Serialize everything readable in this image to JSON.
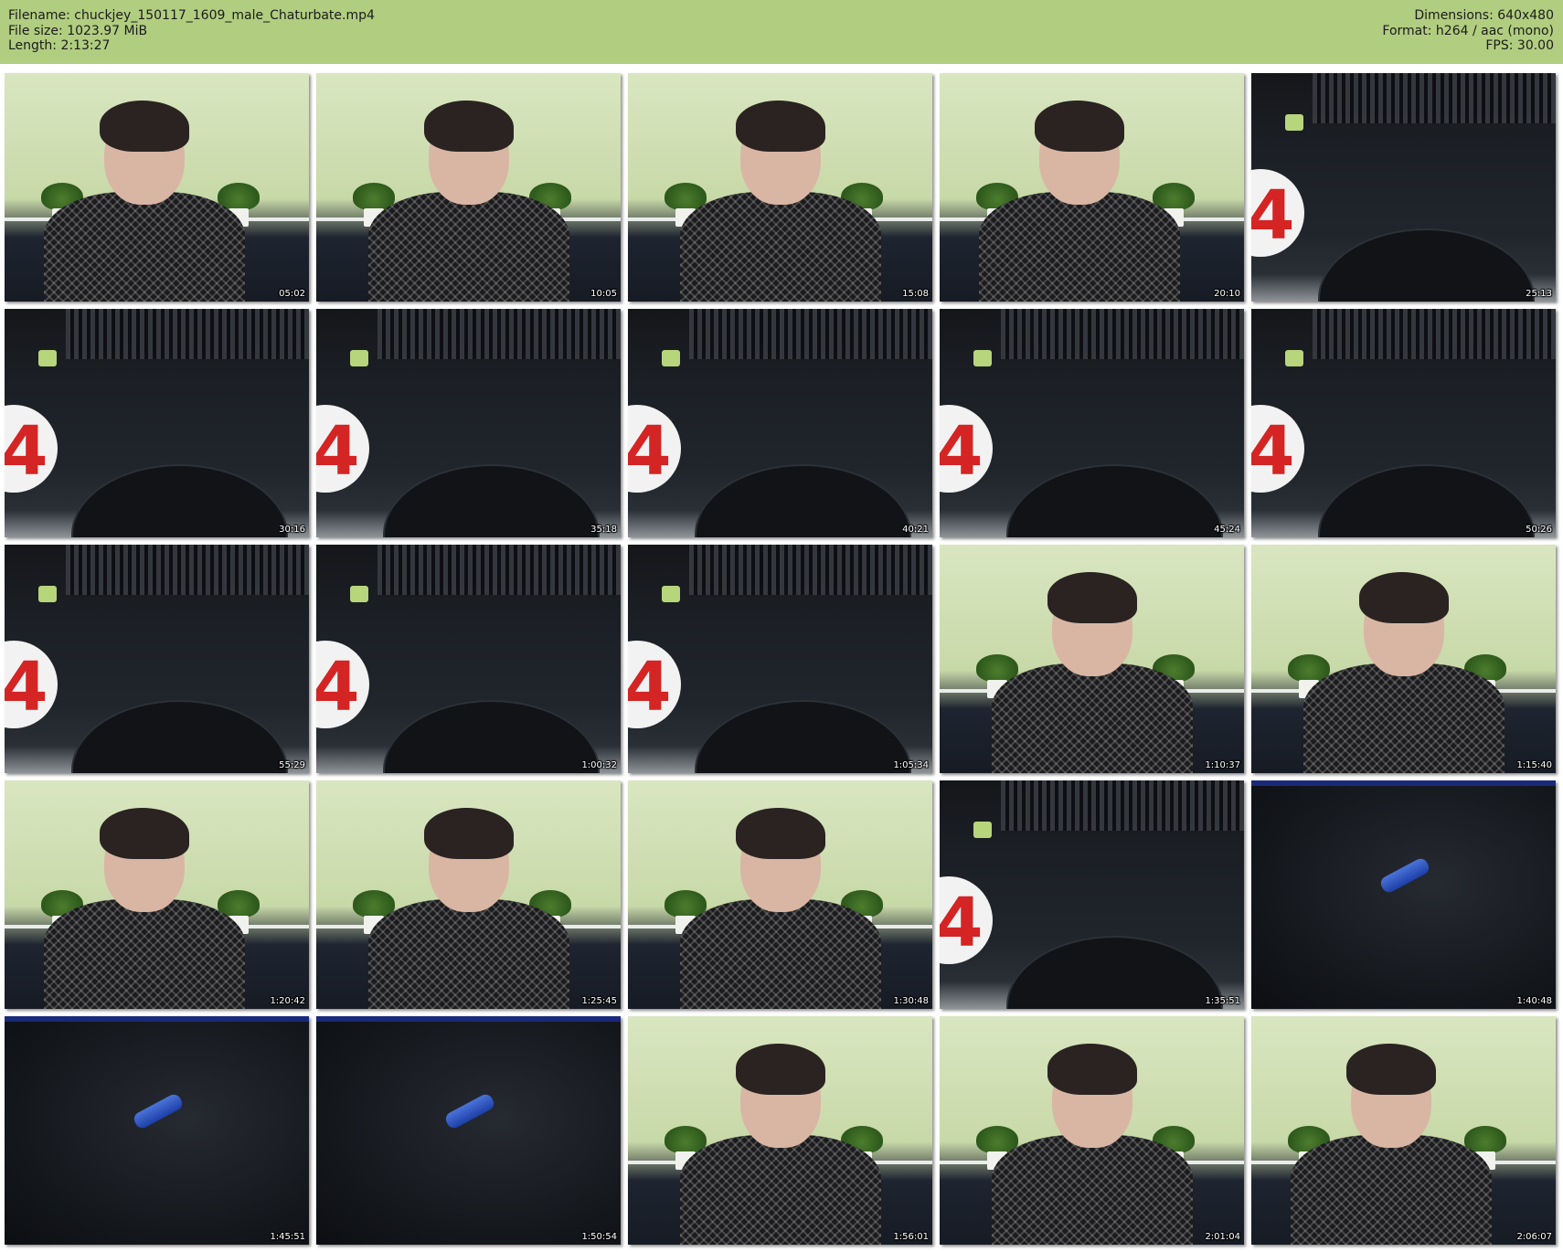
{
  "header": {
    "filename": "Filename: chuckjey_150117_1609_male_Chaturbate.mp4",
    "filesize": "File size: 1023.97 MiB",
    "length": "Length: 2:13:27",
    "dimensions": "Dimensions: 640x480",
    "format": "Format: h264 / aac (mono)",
    "fps": "FPS: 30.00"
  },
  "thumbnails": [
    {
      "time": "05:02",
      "scene": "person"
    },
    {
      "time": "10:05",
      "scene": "person"
    },
    {
      "time": "15:08",
      "scene": "person"
    },
    {
      "time": "20:10",
      "scene": "person"
    },
    {
      "time": "25:13",
      "scene": "desk"
    },
    {
      "time": "30:16",
      "scene": "desk"
    },
    {
      "time": "35:18",
      "scene": "desk"
    },
    {
      "time": "40:21",
      "scene": "desk"
    },
    {
      "time": "45:24",
      "scene": "desk"
    },
    {
      "time": "50:26",
      "scene": "desk"
    },
    {
      "time": "55:29",
      "scene": "desk"
    },
    {
      "time": "1:00:32",
      "scene": "desk"
    },
    {
      "time": "1:05:34",
      "scene": "desk"
    },
    {
      "time": "1:10:37",
      "scene": "person"
    },
    {
      "time": "1:15:40",
      "scene": "person"
    },
    {
      "time": "1:20:42",
      "scene": "person"
    },
    {
      "time": "1:25:45",
      "scene": "person"
    },
    {
      "time": "1:30:48",
      "scene": "person"
    },
    {
      "time": "1:35:51",
      "scene": "desk"
    },
    {
      "time": "1:40:48",
      "scene": "dark"
    },
    {
      "time": "1:45:51",
      "scene": "dark"
    },
    {
      "time": "1:50:54",
      "scene": "dark"
    },
    {
      "time": "1:56:01",
      "scene": "person"
    },
    {
      "time": "2:01:04",
      "scene": "person"
    },
    {
      "time": "2:06:07",
      "scene": "person"
    }
  ]
}
